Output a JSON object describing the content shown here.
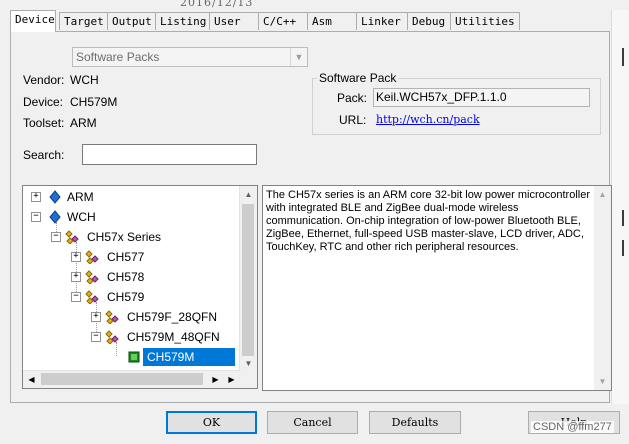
{
  "header_fragment": "2016/12/13",
  "tabs": [
    {
      "label": "Device",
      "active": true
    },
    {
      "label": "Target",
      "active": false
    },
    {
      "label": "Output",
      "active": false
    },
    {
      "label": "Listing",
      "active": false
    },
    {
      "label": "User",
      "active": false
    },
    {
      "label": "C/C++",
      "active": false
    },
    {
      "label": "Asm",
      "active": false
    },
    {
      "label": "Linker",
      "active": false
    },
    {
      "label": "Debug",
      "active": false
    },
    {
      "label": "Utilities",
      "active": false
    }
  ],
  "database_combo": {
    "value": "Software Packs"
  },
  "vendor": {
    "label": "Vendor:",
    "value": "WCH"
  },
  "device": {
    "label": "Device:",
    "value": "CH579M"
  },
  "toolset": {
    "label": "Toolset:",
    "value": "ARM"
  },
  "search": {
    "label": "Search:",
    "value": ""
  },
  "software_pack": {
    "title": "Software Pack",
    "pack_label": "Pack:",
    "pack_value": "Keil.WCH57x_DFP.1.1.0",
    "url_label": "URL:",
    "url_value": "http://wch.cn/pack"
  },
  "tree": {
    "items": [
      {
        "label": "ARM",
        "expander": "+",
        "icon": "diamond-icon"
      },
      {
        "label": "WCH",
        "expander": "−",
        "icon": "diamond-icon"
      },
      {
        "label": "CH57x Series",
        "expander": "−",
        "icon": "family-icon"
      },
      {
        "label": "CH577",
        "expander": "+",
        "icon": "family-icon"
      },
      {
        "label": "CH578",
        "expander": "+",
        "icon": "family-icon"
      },
      {
        "label": "CH579",
        "expander": "−",
        "icon": "family-icon"
      },
      {
        "label": "CH579F_28QFN",
        "expander": "+",
        "icon": "family-icon"
      },
      {
        "label": "CH579M_48QFN",
        "expander": "−",
        "icon": "family-icon"
      },
      {
        "label": "CH579M",
        "expander": "",
        "icon": "chip-icon",
        "selected": true
      }
    ]
  },
  "description": "The CH57x series is an ARM core 32-bit low power microcontroller with integrated BLE and ZigBee dual-mode wireless communication. On-chip integration of low-power Bluetooth BLE, ZigBee, Ethernet, full-speed USB master-slave, LCD driver, ADC, TouchKey, RTC and other rich peripheral resources.",
  "buttons": {
    "ok": "OK",
    "cancel": "Cancel",
    "defaults": "Defaults",
    "help": "Help"
  },
  "watermark": "CSDN @ffm277",
  "colors": {
    "selection": "#0078d7",
    "link": "#0000ee",
    "background": "#f0f0f0"
  }
}
